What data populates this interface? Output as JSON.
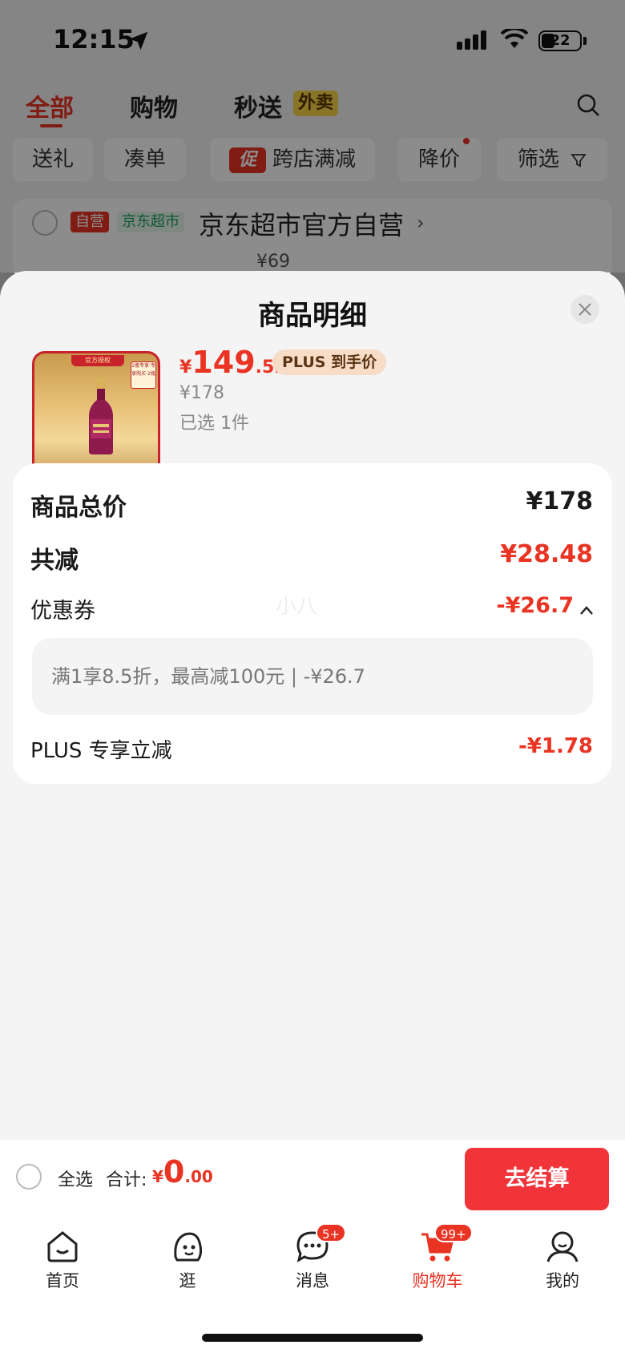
{
  "status_bar": {
    "time": "12:15",
    "battery": "22"
  },
  "top_tabs": {
    "all": "全部",
    "shopping": "购物",
    "express": "秒送",
    "takeout_badge": "外卖",
    "search_icon": "search-icon"
  },
  "filters": {
    "gift": "送礼",
    "bundle": "凑单",
    "promo_badge": "促",
    "cross_store": "跨店满减",
    "price_drop": "降价",
    "filter": "筛选"
  },
  "store": {
    "tag_self": "自营",
    "tag_market": "京东超市",
    "name": "京东超市官方自营",
    "chevron": "›",
    "partial_price": "¥69"
  },
  "sheet": {
    "title": "商品明细",
    "product": {
      "price_currency": "¥",
      "price_int": "149",
      "price_dec": ".52",
      "plus_tag": "PLUS 到手价",
      "original_price": "¥178",
      "selected": "已选 1件",
      "image_banner": "官方授权",
      "image_badge": "1瓶专享·专享购买·2瓶"
    },
    "details": {
      "total_label": "商品总价",
      "total_value": "¥178",
      "discount_label": "共减",
      "discount_value": "¥28.48",
      "coupon_label": "优惠券",
      "coupon_value": "-¥26.7",
      "coupon_desc": "满1享8.5折，最高减100元 | -¥26.7",
      "plus_label": "PLUS 专享立减",
      "plus_value": "-¥1.78",
      "watermark": "小八"
    }
  },
  "checkout": {
    "select_all": "全选",
    "total_label": "合计:",
    "currency": "¥",
    "total_int": "0",
    "total_dec": ".00",
    "button": "去结算"
  },
  "tab_bar": {
    "home": "首页",
    "browse": "逛",
    "messages": "消息",
    "messages_badge": "5+",
    "cart": "购物车",
    "cart_badge": "99+",
    "me": "我的"
  },
  "colors": {
    "accent": "#e93423",
    "checkout_button": "#f1333a"
  }
}
